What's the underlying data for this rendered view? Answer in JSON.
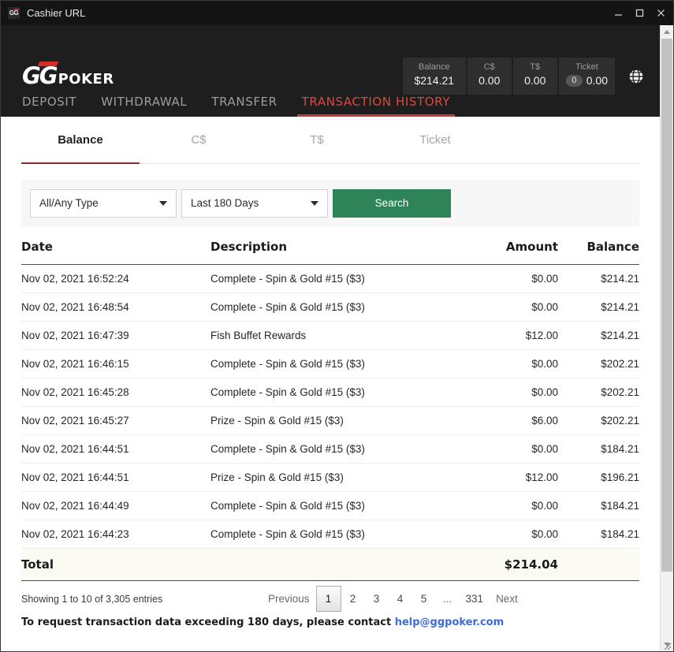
{
  "window": {
    "title": "Cashier URL",
    "app_icon": "gg-app-icon",
    "minimize": "minimize-icon",
    "maximize": "maximize-icon",
    "close": "close-icon"
  },
  "brand": {
    "logo_gg": "GG",
    "logo_poker": "POKER",
    "globe_icon": "globe-icon"
  },
  "balances": [
    {
      "label": "Balance",
      "value": "$214.21"
    },
    {
      "label": "C$",
      "value": "0.00"
    },
    {
      "label": "T$",
      "value": "0.00"
    },
    {
      "label": "Ticket",
      "value": "0.00",
      "chip": "0"
    }
  ],
  "main_nav": [
    {
      "label": "DEPOSIT",
      "active": false
    },
    {
      "label": "WITHDRAWAL",
      "active": false
    },
    {
      "label": "TRANSFER",
      "active": false
    },
    {
      "label": "TRANSACTION HISTORY",
      "active": true
    }
  ],
  "sub_tabs": [
    {
      "label": "Balance",
      "active": true
    },
    {
      "label": "C$",
      "active": false
    },
    {
      "label": "T$",
      "active": false
    },
    {
      "label": "Ticket",
      "active": false
    }
  ],
  "filters": {
    "type_select": "All/Any Type",
    "period_select": "Last 180 Days",
    "search_label": "Search"
  },
  "table": {
    "headers": [
      "Date",
      "Description",
      "Amount",
      "Balance"
    ],
    "rows": [
      {
        "date": "Nov 02, 2021 16:52:24",
        "description": "Complete - Spin & Gold #15 ($3)",
        "amount": "$0.00",
        "balance": "$214.21"
      },
      {
        "date": "Nov 02, 2021 16:48:54",
        "description": "Complete - Spin & Gold #15 ($3)",
        "amount": "$0.00",
        "balance": "$214.21"
      },
      {
        "date": "Nov 02, 2021 16:47:39",
        "description": "Fish Buffet Rewards",
        "amount": "$12.00",
        "balance": "$214.21"
      },
      {
        "date": "Nov 02, 2021 16:46:15",
        "description": "Complete - Spin & Gold #15 ($3)",
        "amount": "$0.00",
        "balance": "$202.21"
      },
      {
        "date": "Nov 02, 2021 16:45:28",
        "description": "Complete - Spin & Gold #15 ($3)",
        "amount": "$0.00",
        "balance": "$202.21"
      },
      {
        "date": "Nov 02, 2021 16:45:27",
        "description": "Prize - Spin & Gold #15 ($3)",
        "amount": "$6.00",
        "balance": "$202.21"
      },
      {
        "date": "Nov 02, 2021 16:44:51",
        "description": "Complete - Spin & Gold #15 ($3)",
        "amount": "$0.00",
        "balance": "$184.21"
      },
      {
        "date": "Nov 02, 2021 16:44:51",
        "description": "Prize - Spin & Gold #15 ($3)",
        "amount": "$12.00",
        "balance": "$196.21"
      },
      {
        "date": "Nov 02, 2021 16:44:49",
        "description": "Complete - Spin & Gold #15 ($3)",
        "amount": "$0.00",
        "balance": "$184.21"
      },
      {
        "date": "Nov 02, 2021 16:44:23",
        "description": "Complete - Spin & Gold #15 ($3)",
        "amount": "$0.00",
        "balance": "$184.21"
      }
    ],
    "total_label": "Total",
    "total_amount": "$214.04",
    "total_balance": ""
  },
  "pagination": {
    "showing": "Showing 1 to 10 of 3,305 entries",
    "previous": "Previous",
    "next": "Next",
    "pages": [
      "1",
      "2",
      "3",
      "4",
      "5",
      "...",
      "331"
    ],
    "current": "1"
  },
  "footer": {
    "text": "To request transaction data exceeding 180 days, please contact ",
    "email": "help@ggpoker.com"
  },
  "colors": {
    "brand_red": "#c23b34",
    "search_green": "#2f8359",
    "link_blue": "#3f6bd6",
    "tab_underline": "#8c2b2b"
  }
}
